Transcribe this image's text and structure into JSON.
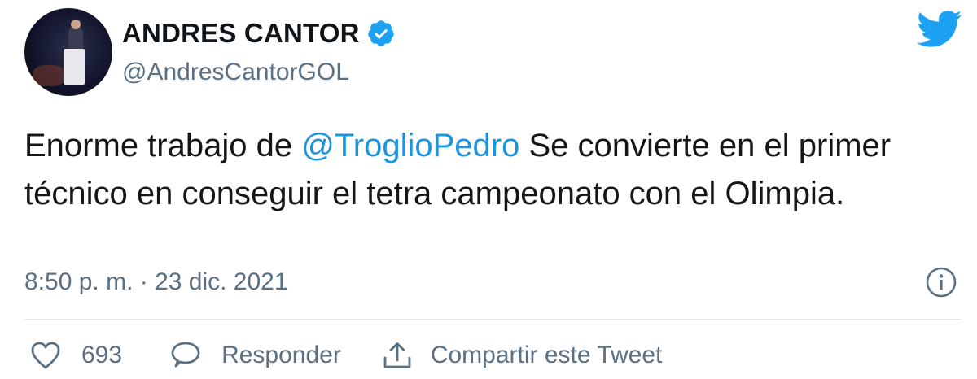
{
  "tweet": {
    "display_name": "ANDRES CANTOR",
    "handle": "@AndresCantorGOL",
    "text_before": "Enorme trabajo de ",
    "mention": "@TroglioPedro",
    "text_after": " Se convierte en el primer técnico en conseguir el tetra campeonato con el Olimpia.",
    "timestamp": "8:50 p. m. · 23 dic. 2021"
  },
  "actions": {
    "like_count": "693",
    "reply_label": "Responder",
    "share_label": "Compartir este Tweet"
  },
  "icons": {
    "verified": "verified-badge-icon",
    "brand": "twitter-bird-icon",
    "info": "info-icon",
    "like": "heart-icon",
    "reply": "speech-bubble-icon",
    "share": "upload-icon"
  },
  "colors": {
    "brand_blue": "#1da1f2",
    "mention_blue": "#1b95e0",
    "secondary_text": "#5b7083"
  }
}
